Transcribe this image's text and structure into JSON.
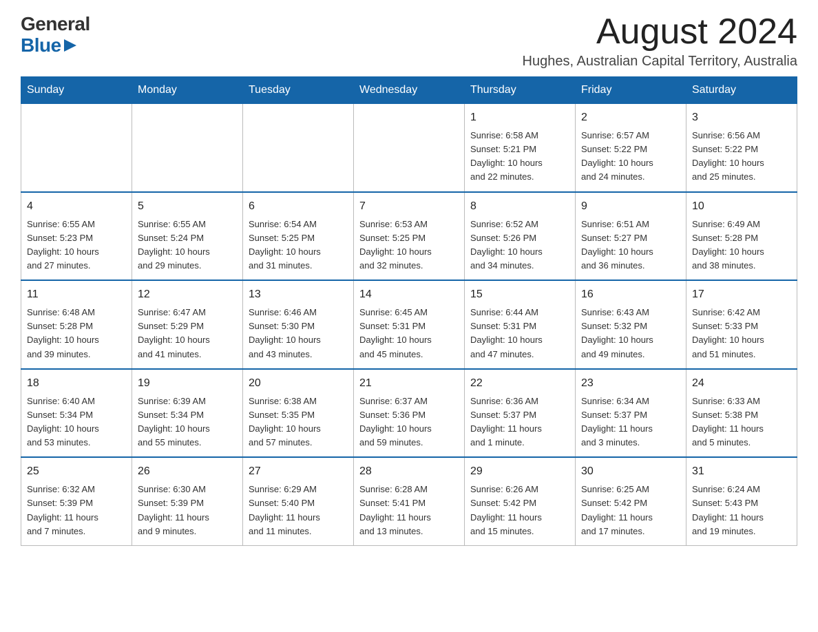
{
  "logo": {
    "general": "General",
    "blue": "Blue",
    "triangle": "▶"
  },
  "header": {
    "month_year": "August 2024",
    "location": "Hughes, Australian Capital Territory, Australia"
  },
  "days_of_week": [
    "Sunday",
    "Monday",
    "Tuesday",
    "Wednesday",
    "Thursday",
    "Friday",
    "Saturday"
  ],
  "weeks": [
    [
      {
        "day": "",
        "info": ""
      },
      {
        "day": "",
        "info": ""
      },
      {
        "day": "",
        "info": ""
      },
      {
        "day": "",
        "info": ""
      },
      {
        "day": "1",
        "info": "Sunrise: 6:58 AM\nSunset: 5:21 PM\nDaylight: 10 hours\nand 22 minutes."
      },
      {
        "day": "2",
        "info": "Sunrise: 6:57 AM\nSunset: 5:22 PM\nDaylight: 10 hours\nand 24 minutes."
      },
      {
        "day": "3",
        "info": "Sunrise: 6:56 AM\nSunset: 5:22 PM\nDaylight: 10 hours\nand 25 minutes."
      }
    ],
    [
      {
        "day": "4",
        "info": "Sunrise: 6:55 AM\nSunset: 5:23 PM\nDaylight: 10 hours\nand 27 minutes."
      },
      {
        "day": "5",
        "info": "Sunrise: 6:55 AM\nSunset: 5:24 PM\nDaylight: 10 hours\nand 29 minutes."
      },
      {
        "day": "6",
        "info": "Sunrise: 6:54 AM\nSunset: 5:25 PM\nDaylight: 10 hours\nand 31 minutes."
      },
      {
        "day": "7",
        "info": "Sunrise: 6:53 AM\nSunset: 5:25 PM\nDaylight: 10 hours\nand 32 minutes."
      },
      {
        "day": "8",
        "info": "Sunrise: 6:52 AM\nSunset: 5:26 PM\nDaylight: 10 hours\nand 34 minutes."
      },
      {
        "day": "9",
        "info": "Sunrise: 6:51 AM\nSunset: 5:27 PM\nDaylight: 10 hours\nand 36 minutes."
      },
      {
        "day": "10",
        "info": "Sunrise: 6:49 AM\nSunset: 5:28 PM\nDaylight: 10 hours\nand 38 minutes."
      }
    ],
    [
      {
        "day": "11",
        "info": "Sunrise: 6:48 AM\nSunset: 5:28 PM\nDaylight: 10 hours\nand 39 minutes."
      },
      {
        "day": "12",
        "info": "Sunrise: 6:47 AM\nSunset: 5:29 PM\nDaylight: 10 hours\nand 41 minutes."
      },
      {
        "day": "13",
        "info": "Sunrise: 6:46 AM\nSunset: 5:30 PM\nDaylight: 10 hours\nand 43 minutes."
      },
      {
        "day": "14",
        "info": "Sunrise: 6:45 AM\nSunset: 5:31 PM\nDaylight: 10 hours\nand 45 minutes."
      },
      {
        "day": "15",
        "info": "Sunrise: 6:44 AM\nSunset: 5:31 PM\nDaylight: 10 hours\nand 47 minutes."
      },
      {
        "day": "16",
        "info": "Sunrise: 6:43 AM\nSunset: 5:32 PM\nDaylight: 10 hours\nand 49 minutes."
      },
      {
        "day": "17",
        "info": "Sunrise: 6:42 AM\nSunset: 5:33 PM\nDaylight: 10 hours\nand 51 minutes."
      }
    ],
    [
      {
        "day": "18",
        "info": "Sunrise: 6:40 AM\nSunset: 5:34 PM\nDaylight: 10 hours\nand 53 minutes."
      },
      {
        "day": "19",
        "info": "Sunrise: 6:39 AM\nSunset: 5:34 PM\nDaylight: 10 hours\nand 55 minutes."
      },
      {
        "day": "20",
        "info": "Sunrise: 6:38 AM\nSunset: 5:35 PM\nDaylight: 10 hours\nand 57 minutes."
      },
      {
        "day": "21",
        "info": "Sunrise: 6:37 AM\nSunset: 5:36 PM\nDaylight: 10 hours\nand 59 minutes."
      },
      {
        "day": "22",
        "info": "Sunrise: 6:36 AM\nSunset: 5:37 PM\nDaylight: 11 hours\nand 1 minute."
      },
      {
        "day": "23",
        "info": "Sunrise: 6:34 AM\nSunset: 5:37 PM\nDaylight: 11 hours\nand 3 minutes."
      },
      {
        "day": "24",
        "info": "Sunrise: 6:33 AM\nSunset: 5:38 PM\nDaylight: 11 hours\nand 5 minutes."
      }
    ],
    [
      {
        "day": "25",
        "info": "Sunrise: 6:32 AM\nSunset: 5:39 PM\nDaylight: 11 hours\nand 7 minutes."
      },
      {
        "day": "26",
        "info": "Sunrise: 6:30 AM\nSunset: 5:39 PM\nDaylight: 11 hours\nand 9 minutes."
      },
      {
        "day": "27",
        "info": "Sunrise: 6:29 AM\nSunset: 5:40 PM\nDaylight: 11 hours\nand 11 minutes."
      },
      {
        "day": "28",
        "info": "Sunrise: 6:28 AM\nSunset: 5:41 PM\nDaylight: 11 hours\nand 13 minutes."
      },
      {
        "day": "29",
        "info": "Sunrise: 6:26 AM\nSunset: 5:42 PM\nDaylight: 11 hours\nand 15 minutes."
      },
      {
        "day": "30",
        "info": "Sunrise: 6:25 AM\nSunset: 5:42 PM\nDaylight: 11 hours\nand 17 minutes."
      },
      {
        "day": "31",
        "info": "Sunrise: 6:24 AM\nSunset: 5:43 PM\nDaylight: 11 hours\nand 19 minutes."
      }
    ]
  ]
}
